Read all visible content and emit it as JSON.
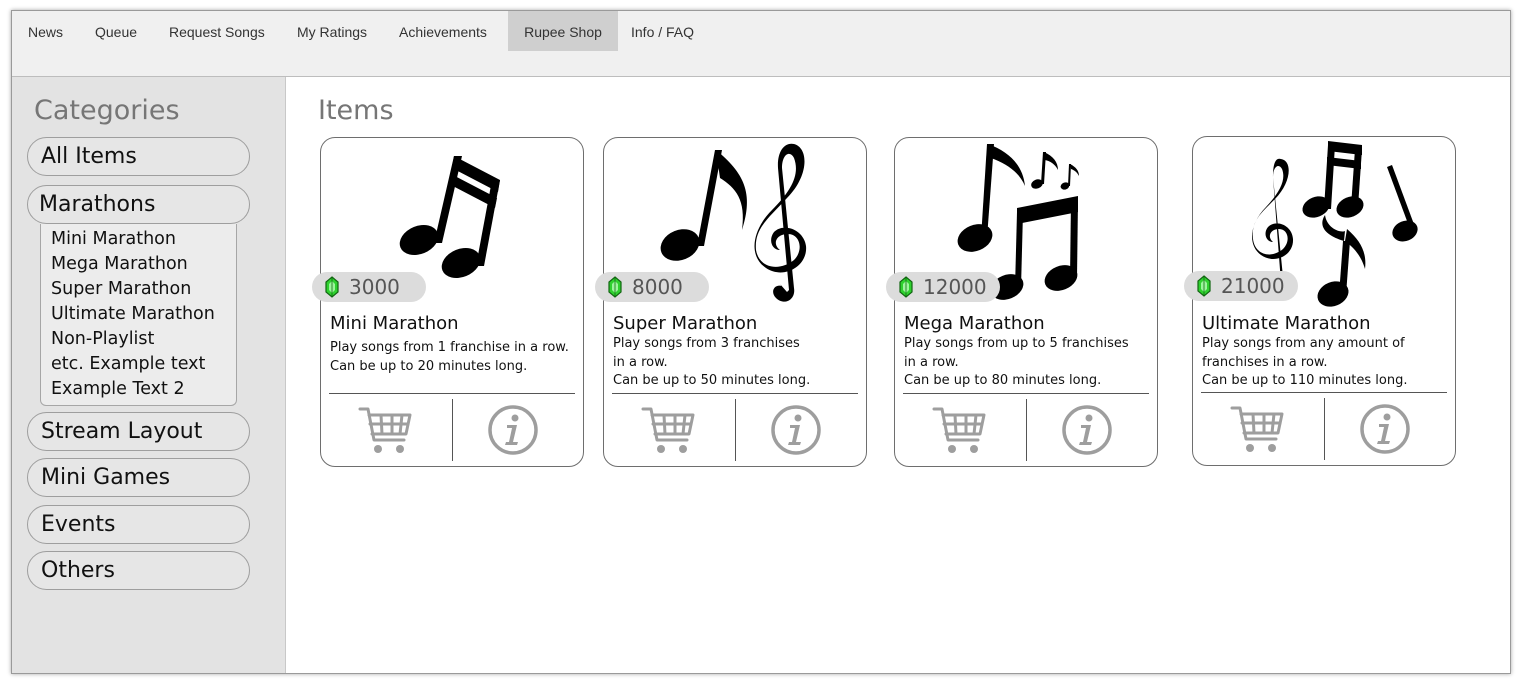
{
  "nav": {
    "items": [
      "News",
      "Queue",
      "Request Songs",
      "My Ratings",
      "Achievements",
      "Rupee Shop",
      "Info / FAQ"
    ],
    "active": "Rupee Shop"
  },
  "sidebar": {
    "title": "Categories",
    "categories": [
      "All Items",
      "Marathons",
      "Stream Layout",
      "Mini Games",
      "Events",
      "Others"
    ],
    "expanded": "Marathons",
    "subitems": [
      "Mini Marathon",
      "Mega Marathon",
      "Super Marathon",
      "Ultimate Marathon",
      "Non-Playlist",
      "etc. Example text",
      "Example Text 2"
    ]
  },
  "main": {
    "title": "Items",
    "items": [
      {
        "name": "Mini Marathon",
        "price": "3000",
        "description": "Play songs from 1 franchise in a row.\nCan be up to 20 minutes long.",
        "icon": "beamed-eighth-notes-icon"
      },
      {
        "name": "Super Marathon",
        "price": "8000",
        "description": "Play songs from 3 franchises\nin a row.\nCan be up to 50 minutes long.",
        "icon": "note-and-treble-clef-icon"
      },
      {
        "name": "Mega Marathon",
        "price": "12000",
        "description": "Play songs from up to 5 franchises\nin a row.\nCan be up to 80 minutes long.",
        "icon": "multiple-notes-icon"
      },
      {
        "name": "Ultimate Marathon",
        "price": "21000",
        "description": "Play songs from any amount of\nfranchises in a row.\nCan be up to 110 minutes long.",
        "icon": "notes-cluster-with-clef-icon"
      }
    ]
  },
  "colors": {
    "rupee": "#2fd12f",
    "active_tab": "#cfcfcf",
    "sidebar_bg": "#e3e3e3",
    "icon_gray": "#9e9e9e"
  }
}
